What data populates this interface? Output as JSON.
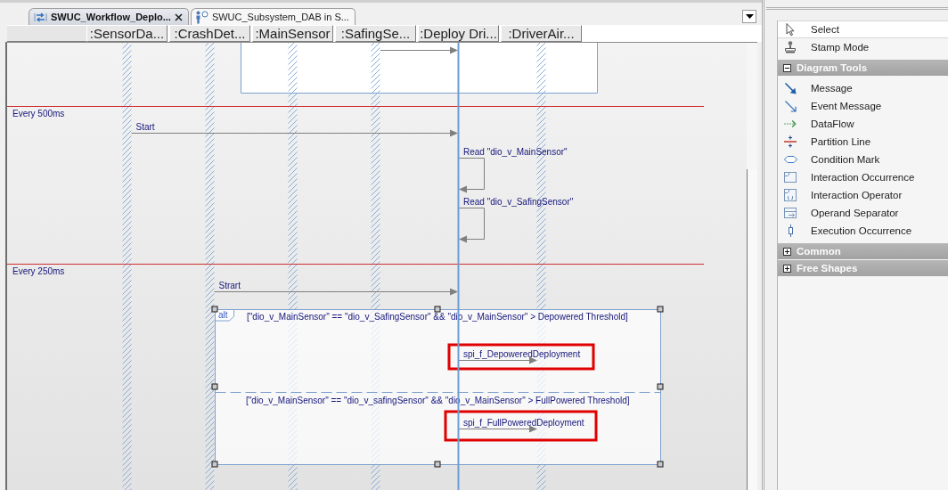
{
  "editor_tabs": [
    {
      "label": "SWUC_Workflow_Deplo...",
      "selected": true,
      "closable": true
    },
    {
      "label": "SWUC_Subsystem_DAB in S...",
      "selected": false,
      "closable": false
    }
  ],
  "lifelines": [
    {
      "label": ":SensorDa...",
      "selected": false
    },
    {
      "label": ":CrashDet...",
      "selected": false
    },
    {
      "label": ":MainSensor",
      "selected": false
    },
    {
      "label": ":SafingSe...",
      "selected": false
    },
    {
      "label": ":Deploy Dri...",
      "selected": true
    },
    {
      "label": ":DriverAir...",
      "selected": false
    }
  ],
  "diagram": {
    "partitions": [
      {
        "label": "Every 500ms",
        "messages": [
          {
            "label": "Start",
            "kind": "call"
          },
          {
            "label": "Read \"dio_v_MainSensor\"",
            "kind": "self"
          },
          {
            "label": "Read \"dio_v_SafingSensor\"",
            "kind": "self"
          }
        ]
      },
      {
        "label": "Every 250ms",
        "messages": [
          {
            "label": "Strart",
            "kind": "call"
          }
        ],
        "fragment": {
          "operator": "alt",
          "selected": true,
          "operands": [
            {
              "guard": "[\"dio_v_MainSensor\" == \"dio_v_SafingSensor\" && \"dio_v_MainSensor\" > Depowered Threshold]",
              "messages": [
                {
                  "label": "spi_f_DepoweredDeployment",
                  "kind": "call",
                  "highlighted": true
                }
              ]
            },
            {
              "guard": "[\"dio_v_MainSensor\" == \"dio_v_safingSensor\" && \"dio_v_MainSensor\" > FullPowered Threshold]",
              "messages": [
                {
                  "label": "spi_f_FullPoweredDeployment",
                  "kind": "call",
                  "highlighted": true
                }
              ]
            }
          ]
        }
      }
    ]
  },
  "toolbox": {
    "tools": [
      {
        "label": "Select",
        "selected": true
      },
      {
        "label": "Stamp Mode",
        "selected": false
      }
    ],
    "groups": [
      {
        "label": "Diagram Tools",
        "expanded": true,
        "tools": [
          {
            "label": "Message",
            "selected": false
          },
          {
            "label": "Event Message",
            "selected": false
          },
          {
            "label": "DataFlow",
            "selected": false
          },
          {
            "label": "Partition Line",
            "selected": false
          },
          {
            "label": "Condition Mark",
            "selected": false
          },
          {
            "label": "Interaction Occurrence",
            "selected": false
          },
          {
            "label": "Interaction Operator",
            "selected": false
          },
          {
            "label": "Operand Separator",
            "selected": false
          },
          {
            "label": "Execution Occurrence",
            "selected": false
          }
        ]
      },
      {
        "label": "Common",
        "expanded": false
      },
      {
        "label": "Free Shapes",
        "expanded": false
      }
    ]
  }
}
